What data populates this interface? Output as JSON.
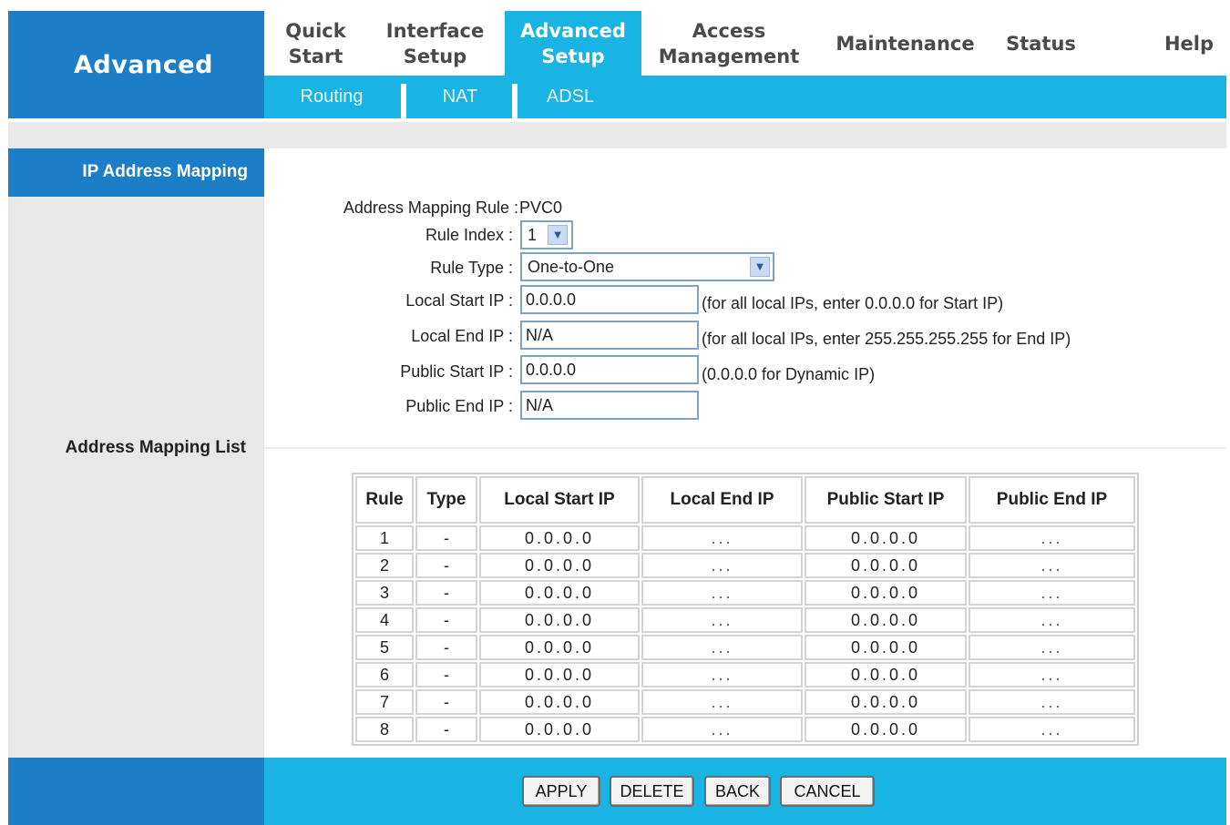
{
  "brand": "Advanced",
  "nav": {
    "tabs": [
      {
        "label_1": "Quick",
        "label_2": "Start"
      },
      {
        "label_1": "Interface",
        "label_2": "Setup"
      },
      {
        "label_1": "Advanced",
        "label_2": "Setup"
      },
      {
        "label_1": "Access",
        "label_2": "Management"
      },
      {
        "label_1": "Maintenance",
        "label_2": ""
      },
      {
        "label_1": "Status",
        "label_2": ""
      },
      {
        "label_1": "Help",
        "label_2": ""
      }
    ],
    "subtabs": [
      "Routing",
      "NAT",
      "ADSL"
    ]
  },
  "section_title": "IP Address Mapping",
  "list_title": "Address Mapping List",
  "form": {
    "mapping_rule_label": "Address Mapping Rule :",
    "mapping_rule_value": "PVC0",
    "rule_index_label": "Rule Index :",
    "rule_index_value": "1",
    "rule_type_label": "Rule Type :",
    "rule_type_value": "One-to-One",
    "local_start_label": "Local Start IP :",
    "local_start_value": "0.0.0.0",
    "local_start_hint": "(for all local IPs, enter 0.0.0.0 for Start IP)",
    "local_end_label": "Local End IP :",
    "local_end_value": "N/A",
    "local_end_hint": "(for all local IPs, enter 255.255.255.255 for End IP)",
    "public_start_label": "Public Start IP :",
    "public_start_value": "0.0.0.0",
    "public_start_hint": "(0.0.0.0 for Dynamic IP)",
    "public_end_label": "Public End IP :",
    "public_end_value": "N/A"
  },
  "table": {
    "headers": [
      "Rule",
      "Type",
      "Local Start IP",
      "Local End IP",
      "Public Start IP",
      "Public End IP"
    ],
    "rows": [
      [
        "1",
        "-",
        "0.0.0.0",
        "...",
        "0.0.0.0",
        "..."
      ],
      [
        "2",
        "-",
        "0.0.0.0",
        "...",
        "0.0.0.0",
        "..."
      ],
      [
        "3",
        "-",
        "0.0.0.0",
        "...",
        "0.0.0.0",
        "..."
      ],
      [
        "4",
        "-",
        "0.0.0.0",
        "...",
        "0.0.0.0",
        "..."
      ],
      [
        "5",
        "-",
        "0.0.0.0",
        "...",
        "0.0.0.0",
        "..."
      ],
      [
        "6",
        "-",
        "0.0.0.0",
        "...",
        "0.0.0.0",
        "..."
      ],
      [
        "7",
        "-",
        "0.0.0.0",
        "...",
        "0.0.0.0",
        "..."
      ],
      [
        "8",
        "-",
        "0.0.0.0",
        "...",
        "0.0.0.0",
        "..."
      ]
    ]
  },
  "buttons": {
    "apply": "APPLY",
    "delete": "DELETE",
    "back": "BACK",
    "cancel": "CANCEL"
  },
  "colors": {
    "dark_blue": "#1d7ec8",
    "light_blue": "#19b3e4",
    "gray": "#e8e8e8"
  }
}
